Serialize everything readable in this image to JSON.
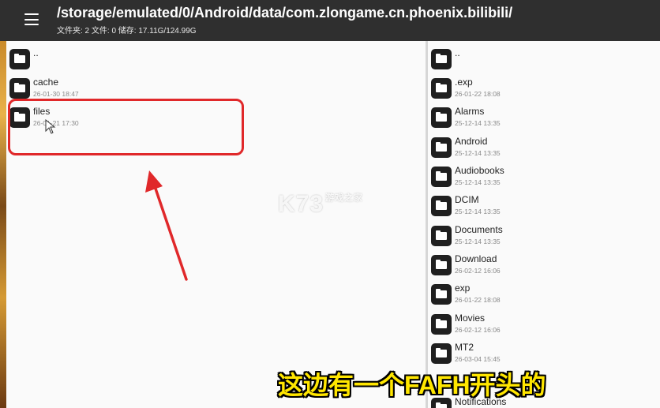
{
  "header": {
    "menu_icon": "hamburger-menu-icon",
    "path": "/storage/emulated/0/Android/data/com.zlongame.cn.phoenix.bilibili/",
    "info": "文件夹: 2  文件: 0  储存: 17.11G/124.99G"
  },
  "left_pane": {
    "items": [
      {
        "name": "..",
        "date": ""
      },
      {
        "name": "cache",
        "date": "26-01-30 18:47"
      },
      {
        "name": "files",
        "date": "26-01-21 17:30"
      }
    ]
  },
  "right_pane": {
    "items": [
      {
        "name": "..",
        "date": ""
      },
      {
        "name": ".exp",
        "date": "26-01-22 18:08"
      },
      {
        "name": "Alarms",
        "date": "25-12-14 13:35"
      },
      {
        "name": "Android",
        "date": "25-12-14 13:35"
      },
      {
        "name": "Audiobooks",
        "date": "25-12-14 13:35"
      },
      {
        "name": "DCIM",
        "date": "25-12-14 13:35"
      },
      {
        "name": "Documents",
        "date": "25-12-14 13:35"
      },
      {
        "name": "Download",
        "date": "26-02-12 16:06"
      },
      {
        "name": "exp",
        "date": "26-01-22 18:08"
      },
      {
        "name": "Movies",
        "date": "26-02-12 16:06"
      },
      {
        "name": "MT2",
        "date": "26-03-04 15:45"
      },
      {
        "name": "Notifications",
        "date": ""
      }
    ]
  },
  "overlay": {
    "watermark": "K73",
    "watermark_sub": "游戏之家",
    "subtitle": "这边有一个FAFH开头的"
  },
  "colors": {
    "topbar": "#2f2f2f",
    "highlight": "#e0282a",
    "subtitle": "#ffe600"
  }
}
